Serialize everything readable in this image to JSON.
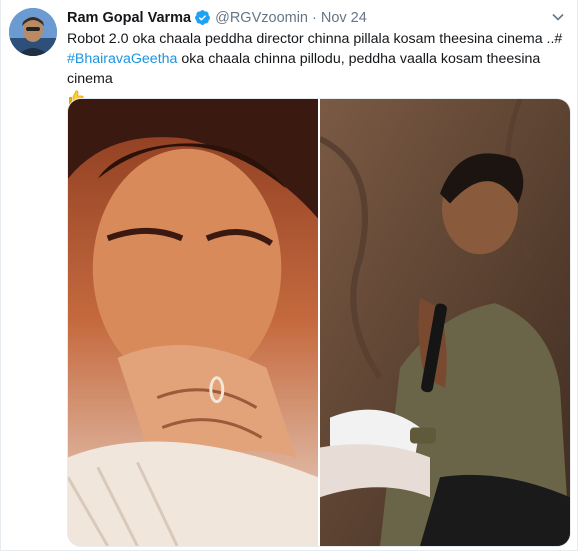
{
  "tweet": {
    "author_name": "Ram Gopal Varma",
    "author_handle": "@RGVzoomin",
    "separator": "·",
    "timestamp": "Nov 24",
    "text_part1": "Robot 2.0 oka chaala peddha director chinna pillala kosam theesina cinema   ..",
    "hashtag1": "#",
    "hashtag2": "#BhairavaGeetha",
    "text_part2": " oka chaala chinna pillodu, peddha vaalla kosam theesina cinema "
  },
  "icons": {
    "verified": "verified-badge-icon",
    "caret": "chevron-down-icon",
    "thumbs_up": "thumbs-up-emoji"
  },
  "colors": {
    "link": "#1b95e0",
    "muted": "#657786",
    "verified": "#1da1f2"
  }
}
